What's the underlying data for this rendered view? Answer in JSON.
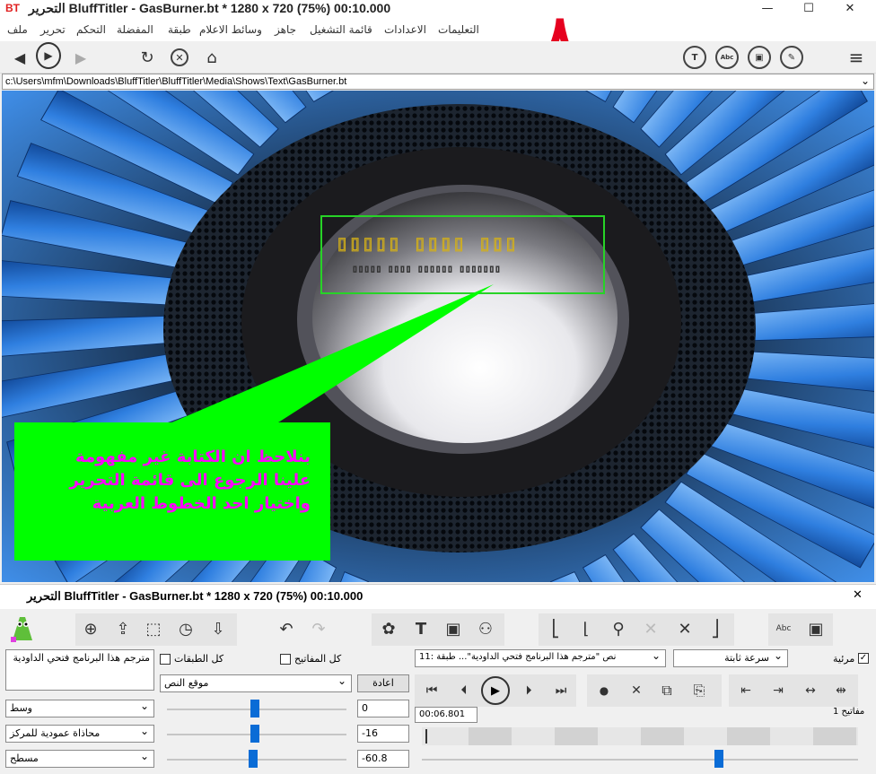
{
  "window": {
    "logo": "BT",
    "title": "التحرير  BluffTitler - GasBurner.bt * 1280 x 720 (75%) 00:10.000",
    "minimize": "—",
    "maximize": "☐",
    "close": "✕"
  },
  "menu": {
    "items": [
      "ملف",
      "تحرير",
      "التحكم",
      "المفضلة",
      "طبقة",
      "وسائط الاعلام",
      "جاهز",
      "قائمة التشغيل",
      "الاعدادات",
      "التعليمات"
    ]
  },
  "annotation_number": "٨",
  "toolbar": {
    "back": "◀",
    "play": "▶",
    "forward": "▶",
    "refresh": "↻",
    "stop": "✕",
    "home": "⌂",
    "text_btn": "T",
    "abc_btn": "Abc",
    "image_btn": "▣",
    "pen_btn": "✎",
    "menu_btn": "≡"
  },
  "path": {
    "value": "c:\\Users\\mfm\\Downloads\\BluffTitler\\BluffTitler\\Media\\Shows\\Text\\GasBurner.bt"
  },
  "callout": {
    "line1": "بنلاحظ ان الكتابة غير مفهومة",
    "line2": "علينا الرجوع الى قائمة التحرير",
    "line3": "واختيار احد الخطوط العربية"
  },
  "render_text": {
    "row1": "▯▯▯▯▯ ▯▯▯▯ ▯▯▯",
    "row2": "▯▯▯▯▯ ▯▯▯▯ ▯▯▯▯▯▯ ▯▯▯▯▯▯▯"
  },
  "panel": {
    "title": "التحرير  BluffTitler - GasBurner.bt * 1280 x 720 (75%) 00:10.000",
    "close": "✕",
    "text_box": "مترجم هذا البرنامج فتحي الداودية",
    "all_layers": "كل الطبقات",
    "all_keys": "كل المفاتيح",
    "reset": "اعادة",
    "text_position": "موقع النص",
    "align_h": "وسط",
    "align_v": "محاذاة عمودية للمركز",
    "flat": "مسطح",
    "value1": "0",
    "value2": "-16",
    "value3": "-60.8",
    "layer_select": "11: نص \"مترجم هذا البرنامج فتحي الداودية\"... طبقة",
    "speed_select": "سرعة ثابتة",
    "visible_label": "مرئية",
    "visible_checked": "✓",
    "time": "00:06.801",
    "keys_label": "مفاتيح 1"
  },
  "colors": {
    "callout_bg": "#00ff00",
    "callout_text": "#ff00ff",
    "annotation": "#e6001f",
    "slider": "#0a6cd6"
  }
}
